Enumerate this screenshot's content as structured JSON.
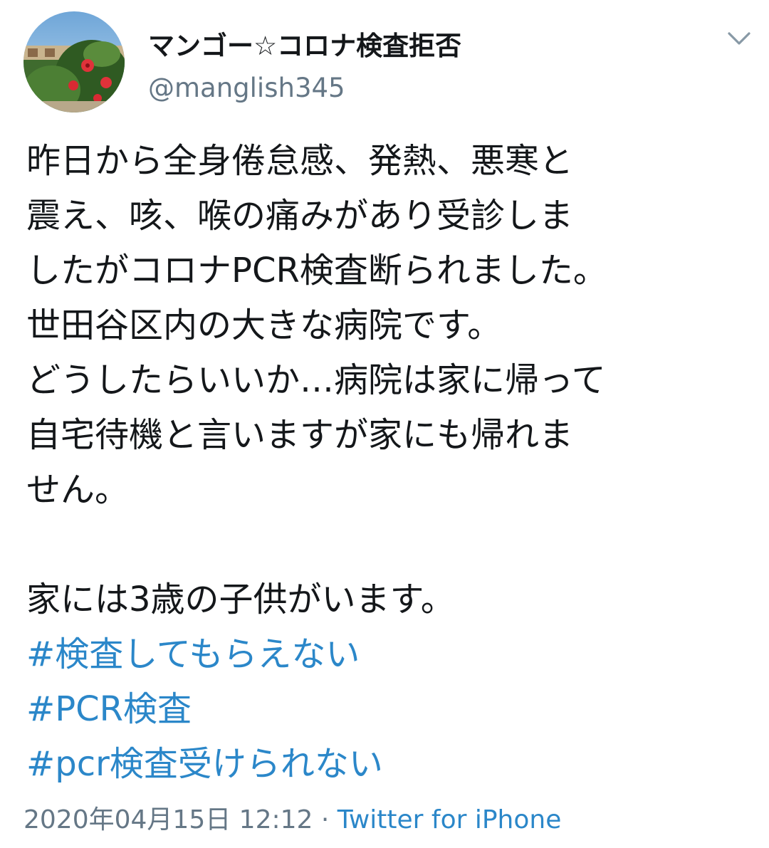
{
  "user": {
    "display_name": "マンゴー☆コロナ検査拒否",
    "handle": "@manglish345"
  },
  "tweet": {
    "lines": [
      "昨日から全身倦怠感、発熱、悪寒と",
      "震え、咳、喉の痛みがあり受診しま",
      "したがコロナPCR検査断られました。",
      "世田谷区内の大きな病院です。",
      "どうしたらいいか…病院は家に帰って",
      "自宅待機と言いますが家にも帰れま",
      "せん。"
    ],
    "line_after_gap": "家には3歳の子供がいます。",
    "hashtags": [
      "#検査してもらえない",
      "#PCR検査",
      "#pcr検査受けられない"
    ]
  },
  "meta": {
    "timestamp": "2020年04月15日 12:12",
    "separator": "·",
    "source": "Twitter for iPhone"
  },
  "icons": {
    "caret": "chevron-down-icon",
    "avatar": "avatar-photo-hibiscus"
  },
  "colors": {
    "text": "#14171a",
    "secondary": "#657786",
    "link": "#2b87c9"
  }
}
